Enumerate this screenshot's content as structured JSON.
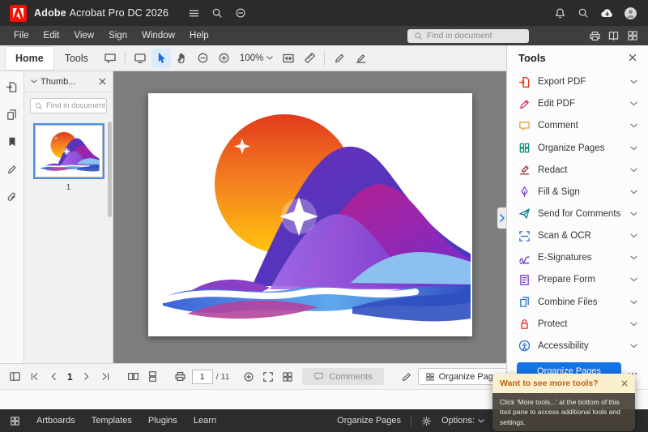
{
  "titlebar": {
    "brand_bold": "Adobe",
    "brand_rest": "Acrobat Pro DC 2026"
  },
  "menubar": {
    "items": [
      "File",
      "Edit",
      "View",
      "Sign",
      "Window",
      "Help"
    ],
    "search_placeholder": "Find in document"
  },
  "toolbar": {
    "tabs": [
      "Home",
      "Tools"
    ],
    "active_tab": "Home",
    "zoom_value": "100%"
  },
  "thumbnails_panel": {
    "header": "Thumb...",
    "search_placeholder": "Find in document",
    "page_label": "1"
  },
  "tools_panel": {
    "title": "Tools",
    "items": [
      {
        "label": "Export PDF",
        "icon": "export-pdf-icon",
        "color": "#E4340C"
      },
      {
        "label": "Edit PDF",
        "icon": "edit-pdf-icon",
        "color": "#D6336C"
      },
      {
        "label": "Comment",
        "icon": "comment-icon",
        "color": "#E8A33D"
      },
      {
        "label": "Organize Pages",
        "icon": "organize-pages-icon",
        "color": "#12907E"
      },
      {
        "label": "Redact",
        "icon": "redact-icon",
        "color": "#8E2433"
      },
      {
        "label": "Fill & Sign",
        "icon": "fill-sign-icon",
        "color": "#7B4CD6"
      },
      {
        "label": "Send for Comments",
        "icon": "send-comments-icon",
        "color": "#0E7F8C"
      },
      {
        "label": "Scan & OCR",
        "icon": "scan-ocr-icon",
        "color": "#2B6FD4"
      },
      {
        "label": "E-Signatures",
        "icon": "e-signatures-icon",
        "color": "#6A3FC4"
      },
      {
        "label": "Prepare Form",
        "icon": "prepare-form-icon",
        "color": "#8248C9"
      },
      {
        "label": "Combine Files",
        "icon": "combine-files-icon",
        "color": "#2B6FD4"
      },
      {
        "label": "Protect",
        "icon": "protect-icon",
        "color": "#D92D2D"
      },
      {
        "label": "Accessibility",
        "icon": "accessibility-icon",
        "color": "#2B6FD4"
      }
    ],
    "primary_button": "Organize Pages",
    "more_button": "..."
  },
  "bottom_toolbar": {
    "nav_page": "1",
    "page_input": "1",
    "page_total": "/ 11",
    "comments_button": "Comments",
    "organize_dropdown": "Organize Pages"
  },
  "taskbar": {
    "items": [
      "Artboards",
      "Templates",
      "Plugins",
      "Learn"
    ],
    "context_label": "Organize Pages",
    "options_label": "Options:"
  },
  "tooltip": {
    "title": "Want to see more tools?",
    "body": "Click 'More tools...' at the bottom of this tool pane to access additional tools and settings."
  },
  "icons": {
    "close": "x cross",
    "chevron_down": "v chevron",
    "search": "magnifier",
    "hamburger_menu": "three lines",
    "bell": "notifications",
    "cloud": "cloud with down arrow",
    "avatar": "person in circle",
    "pointer": "selection arrow (blue)",
    "hand": "pan hand",
    "zoom_out": "circled minus",
    "zoom_in": "circled plus"
  },
  "colors": {
    "accent_blue": "#1473E6",
    "adobe_red": "#FA0F00",
    "canvas_gray": "#7E7E7E"
  }
}
